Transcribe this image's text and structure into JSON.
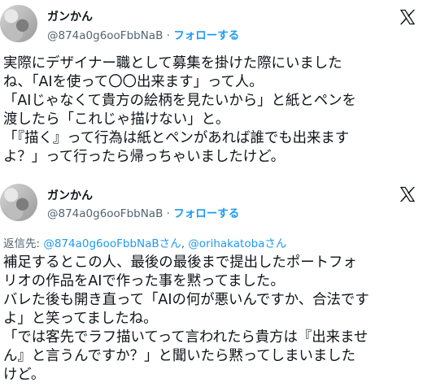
{
  "tweets": [
    {
      "display_name": "ガンかん",
      "handle": "@874a0g6ooFbbNaB",
      "separator": "·",
      "follow_label": "フォローする",
      "logo_icon": "x-logo-icon",
      "body": "実際にデザイナー職として募集を掛けた際にいました\nね、「AIを使って〇〇出来ます」って人。\n「AIじゃなくて貴方の絵柄を見たいから」と紙とペンを\n渡したら「これじゃ描けない」と。\n「『描く』って行為は紙とペンがあれば誰でも出来ます\nよ？」って行ったら帰っちゃいましたけど。"
    },
    {
      "display_name": "ガンかん",
      "handle": "@874a0g6ooFbbNaB",
      "separator": "·",
      "follow_label": "フォローする",
      "logo_icon": "x-logo-icon",
      "reply_prefix": "返信先: ",
      "reply_mention_1": "@874a0g6ooFbbNaBさん",
      "reply_sep": ", ",
      "reply_mention_2": "@orihakatobaさん",
      "body": "補足するとこの人、最後の最後まで提出したポートフォ\nリオの作品をAIで作った事を黙ってました。\nバレた後も開き直って「AIの何が悪いんですか、合法です\nよ」と笑ってましたね。\n「では客先でラフ描いてって言われたら貴方は『出来ませ\nん』と言うんですか？」と聞いたら黙ってしまいました\nけど。"
    }
  ]
}
